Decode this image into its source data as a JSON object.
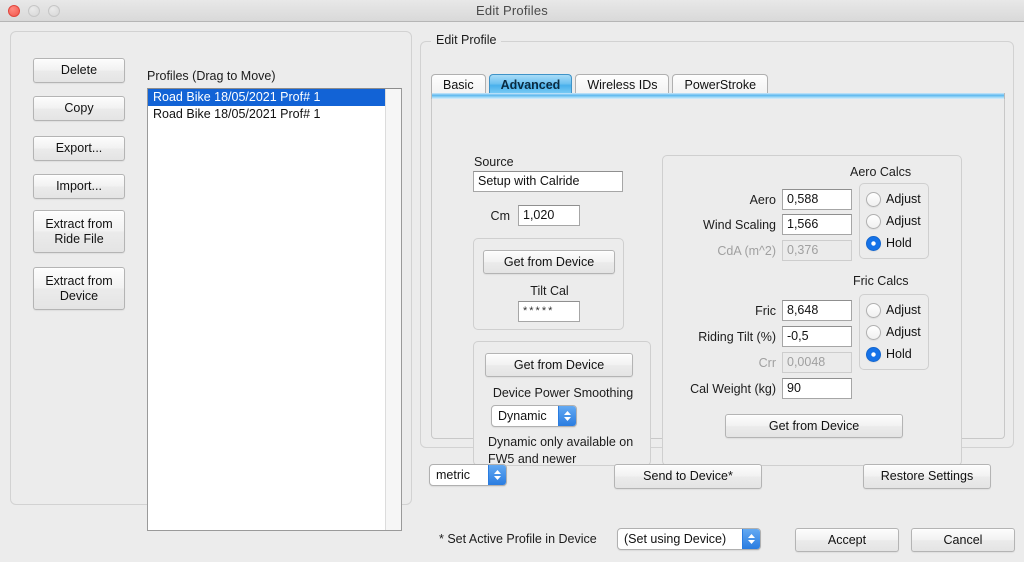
{
  "window": {
    "title": "Edit Profiles",
    "traffic_lights": [
      "close-button",
      "minimize-button",
      "zoom-button"
    ]
  },
  "sidebar": {
    "buttons": [
      {
        "label": "Delete",
        "name": "delete-button"
      },
      {
        "label": "Copy",
        "name": "copy-button"
      },
      {
        "label": "Export...",
        "name": "export-button"
      },
      {
        "label": "Import...",
        "name": "import-button"
      },
      {
        "label_line1": "Extract from",
        "label_line2": "Ride File",
        "name": "extract-from-ride-file-button"
      },
      {
        "label_line1": "Extract from",
        "label_line2": "Device",
        "name": "extract-from-device-button"
      }
    ]
  },
  "profiles": {
    "label": "Profiles (Drag to Move)",
    "items": [
      {
        "text": "Road Bike 18/05/2021 Prof# 1",
        "selected": true
      },
      {
        "text": "Road Bike 18/05/2021 Prof# 1",
        "selected": false
      }
    ]
  },
  "edit_profile": {
    "legend": "Edit Profile",
    "tabs": [
      {
        "label": "Basic",
        "active": false
      },
      {
        "label": "Advanced",
        "active": true
      },
      {
        "label": "Wireless IDs",
        "active": false
      },
      {
        "label": "PowerStroke",
        "active": false
      }
    ],
    "source": {
      "label": "Source",
      "value": "Setup with Calride",
      "cm_label": "Cm",
      "cm_value": "1,020"
    },
    "tilt_frame": {
      "get_from_device": "Get from Device",
      "tilt_cal_label": "Tilt Cal",
      "tilt_cal_value": "*****"
    },
    "smoothing_frame": {
      "get_from_device": "Get from Device",
      "label": "Device Power Smoothing",
      "value": "Dynamic",
      "note_line1": "Dynamic only available on",
      "note_line2": "FW5 and newer"
    },
    "aero": {
      "title": "Aero Calcs",
      "rows": [
        {
          "label": "Aero",
          "value": "0,588",
          "disabled": false,
          "radio": "Adjust",
          "selected": false
        },
        {
          "label": "Wind Scaling",
          "value": "1,566",
          "disabled": false,
          "radio": "Adjust",
          "selected": false
        },
        {
          "label": "CdA (m^2)",
          "value": "0,376",
          "disabled": true,
          "radio": "Hold",
          "selected": true
        }
      ]
    },
    "fric": {
      "title": "Fric Calcs",
      "rows": [
        {
          "label": "Fric",
          "value": "8,648",
          "disabled": false,
          "radio": "Adjust",
          "selected": false
        },
        {
          "label": "Riding Tilt (%)",
          "value": "-0,5",
          "disabled": false,
          "radio": "Adjust",
          "selected": false
        },
        {
          "label": "Crr",
          "value": "0,0048",
          "disabled": true,
          "radio": "Hold",
          "selected": true
        }
      ],
      "cal_weight_label": "Cal Weight (kg)",
      "cal_weight_value": "90",
      "get_from_device": "Get from Device"
    }
  },
  "footer": {
    "units_value": "metric",
    "send_to_device": "Send to Device*",
    "restore_settings": "Restore Settings",
    "active_profile_note": "* Set Active Profile in Device",
    "active_profile_value": "(Set using Device)",
    "accept": "Accept",
    "cancel": "Cancel"
  },
  "colors": {
    "accent_blue": "#1263d6",
    "tab_active": "#49b0ec",
    "window_bg": "#ececec"
  }
}
